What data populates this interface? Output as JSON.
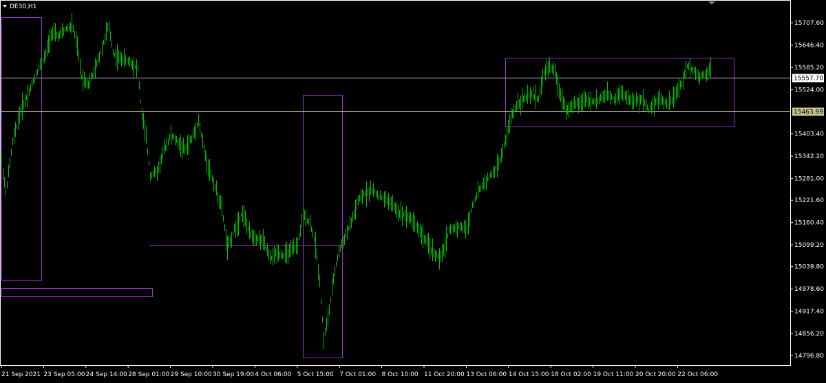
{
  "window": {
    "title": "DE30,H1"
  },
  "colors": {
    "background": "#000000",
    "frame": "#ffffff",
    "bars": "#00c000",
    "boxes": "#9b30d0",
    "hline_upper": "#c8b4e8",
    "hline_lower": "#d8d8a0",
    "tag_upper_bg": "#ffffff",
    "tag_lower_bg": "#c8c48c"
  },
  "chart_data": {
    "type": "bar",
    "symbol": "DE30",
    "timeframe": "H1",
    "ylim": [
      14770,
      15770
    ],
    "y_ticks": [
      "15707.60",
      "15646.40",
      "15585.20",
      "15524.00",
      "15403.40",
      "15342.20",
      "15281.00",
      "15221.60",
      "15160.40",
      "15099.20",
      "15039.80",
      "14978.60",
      "14917.40",
      "14856.20",
      "14796.80"
    ],
    "x_ticks": [
      "21 Sep 2021",
      "23 Sep 05:00",
      "24 Sep 14:00",
      "28 Sep 01:00",
      "29 Sep 10:00",
      "30 Sep 19:00",
      "4 Oct 06:00",
      "5 Oct 15:00",
      "7 Oct 01:00",
      "8 Oct 10:00",
      "11 Oct 20:00",
      "13 Oct 06:00",
      "14 Oct 15:00",
      "18 Oct 02:00",
      "19 Oct 11:00",
      "20 Oct 20:00",
      "22 Oct 06:00"
    ],
    "horizontal_lines": [
      {
        "price": 15557.7,
        "label": "15557.70"
      },
      {
        "price": 15463.99,
        "label": "15463.99"
      }
    ],
    "price_path": [
      [
        0,
        15360
      ],
      [
        8,
        15240
      ],
      [
        18,
        15380
      ],
      [
        30,
        15470
      ],
      [
        42,
        15520
      ],
      [
        55,
        15580
      ],
      [
        66,
        15620
      ],
      [
        74,
        15680
      ],
      [
        85,
        15670
      ],
      [
        95,
        15690
      ],
      [
        105,
        15700
      ],
      [
        112,
        15640
      ],
      [
        118,
        15560
      ],
      [
        128,
        15540
      ],
      [
        138,
        15580
      ],
      [
        148,
        15640
      ],
      [
        157,
        15700
      ],
      [
        165,
        15620
      ],
      [
        175,
        15610
      ],
      [
        190,
        15600
      ],
      [
        200,
        15580
      ],
      [
        205,
        15470
      ],
      [
        212,
        15390
      ],
      [
        218,
        15290
      ],
      [
        228,
        15300
      ],
      [
        238,
        15360
      ],
      [
        248,
        15400
      ],
      [
        258,
        15380
      ],
      [
        268,
        15360
      ],
      [
        278,
        15390
      ],
      [
        288,
        15440
      ],
      [
        298,
        15340
      ],
      [
        310,
        15270
      ],
      [
        322,
        15200
      ],
      [
        330,
        15090
      ],
      [
        340,
        15140
      ],
      [
        352,
        15190
      ],
      [
        362,
        15130
      ],
      [
        372,
        15120
      ],
      [
        382,
        15110
      ],
      [
        392,
        15060
      ],
      [
        402,
        15080
      ],
      [
        412,
        15070
      ],
      [
        422,
        15080
      ],
      [
        432,
        15100
      ],
      [
        440,
        15180
      ],
      [
        450,
        15160
      ],
      [
        458,
        15100
      ],
      [
        464,
        15000
      ],
      [
        470,
        14840
      ],
      [
        478,
        14920
      ],
      [
        486,
        15030
      ],
      [
        492,
        15080
      ],
      [
        500,
        15120
      ],
      [
        510,
        15160
      ],
      [
        520,
        15220
      ],
      [
        530,
        15240
      ],
      [
        540,
        15250
      ],
      [
        552,
        15230
      ],
      [
        565,
        15220
      ],
      [
        578,
        15190
      ],
      [
        590,
        15180
      ],
      [
        602,
        15160
      ],
      [
        615,
        15120
      ],
      [
        628,
        15080
      ],
      [
        640,
        15060
      ],
      [
        652,
        15140
      ],
      [
        665,
        15150
      ],
      [
        678,
        15140
      ],
      [
        686,
        15210
      ],
      [
        696,
        15250
      ],
      [
        708,
        15280
      ],
      [
        718,
        15300
      ],
      [
        728,
        15340
      ],
      [
        736,
        15400
      ],
      [
        742,
        15450
      ],
      [
        752,
        15490
      ],
      [
        762,
        15500
      ],
      [
        772,
        15510
      ],
      [
        782,
        15500
      ],
      [
        790,
        15570
      ],
      [
        798,
        15590
      ],
      [
        806,
        15570
      ],
      [
        814,
        15510
      ],
      [
        822,
        15470
      ],
      [
        832,
        15480
      ],
      [
        842,
        15490
      ],
      [
        852,
        15500
      ],
      [
        862,
        15490
      ],
      [
        872,
        15500
      ],
      [
        882,
        15510
      ],
      [
        892,
        15500
      ],
      [
        902,
        15520
      ],
      [
        912,
        15500
      ],
      [
        922,
        15490
      ],
      [
        932,
        15500
      ],
      [
        942,
        15470
      ],
      [
        950,
        15490
      ],
      [
        960,
        15500
      ],
      [
        970,
        15480
      ],
      [
        980,
        15510
      ],
      [
        990,
        15540
      ],
      [
        998,
        15590
      ],
      [
        1006,
        15580
      ],
      [
        1016,
        15560
      ],
      [
        1024,
        15570
      ],
      [
        1032,
        15580
      ]
    ],
    "x_range": [
      0,
      1040
    ]
  }
}
